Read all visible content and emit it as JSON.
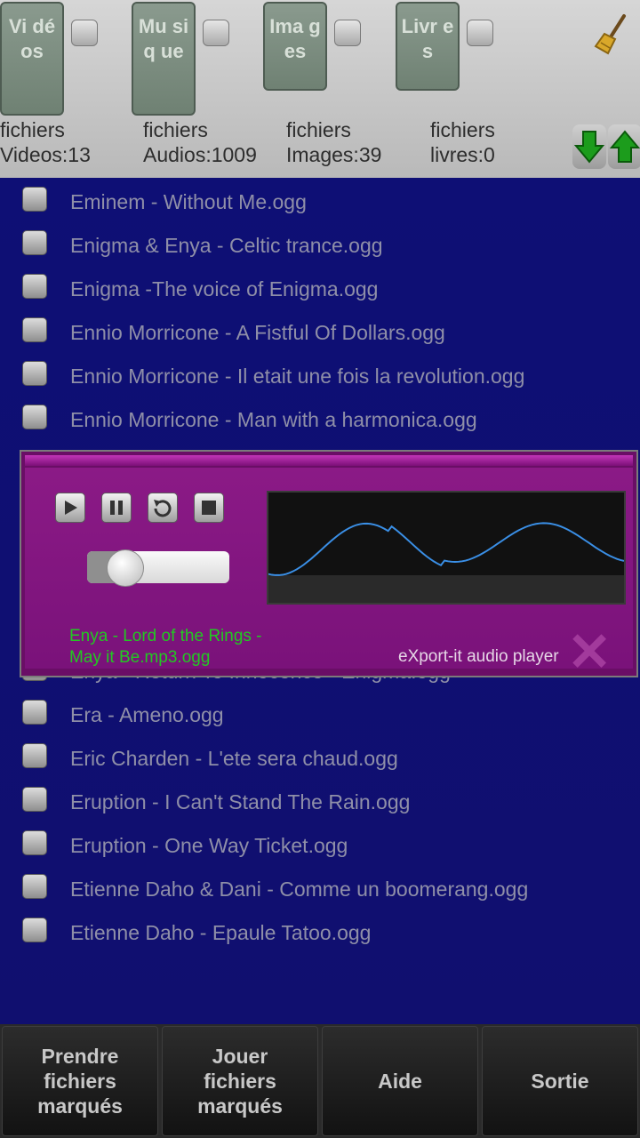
{
  "categories": [
    {
      "label": "Vi dé os",
      "count_prefix": "fichiers",
      "count_text": "Videos:13"
    },
    {
      "label": "Mu siq ue",
      "count_prefix": "fichiers",
      "count_text": "Audios:1009"
    },
    {
      "label": "Ima ges",
      "count_prefix": "fichiers",
      "count_text": "Images:39"
    },
    {
      "label": "Livr es",
      "count_prefix": "fichiers",
      "count_text": "livres:0"
    }
  ],
  "icons": {
    "clear": "broom-icon",
    "down": "arrow-down-icon",
    "up": "arrow-up-icon"
  },
  "files": [
    "Eminem - Without Me.ogg",
    "Enigma & Enya - Celtic trance.ogg",
    "Enigma -The voice of Enigma.ogg",
    "Ennio Morricone - A Fistful Of Dollars.ogg",
    "Ennio Morricone - Il etait une fois la revolution.ogg",
    "Ennio Morricone - Man with a harmonica.ogg",
    "Enya - Lord of the Rings - May it Be.mp3.ogg",
    "Enya - Return To Innocence - Enigma.ogg",
    "Era - Ameno.ogg",
    "Eric Charden - L'ete sera chaud.ogg",
    "Eruption - I Can't Stand The Rain.ogg",
    "Eruption - One Way Ticket.ogg",
    "Etienne Daho & Dani - Comme un boomerang.ogg",
    "Etienne Daho - Epaule Tatoo.ogg"
  ],
  "player": {
    "track": "Enya - Lord of the Rings - May it Be.mp3.ogg",
    "brand": "eXport-it audio player",
    "seek_fraction": 0.25,
    "controls": [
      "play-icon",
      "pause-icon",
      "rewind-icon",
      "stop-icon"
    ]
  },
  "bottom": {
    "take_marked": "Prendre\nfichiers\nmarqués",
    "play_marked": "Jouer\nfichiers\nmarqués",
    "help": "Aide",
    "exit": "Sortie"
  },
  "colors": {
    "list_bg": "#0e0f75",
    "player_bg": "#7a127a",
    "track_text": "#22c822",
    "wave_line": "#3a8fe6"
  }
}
